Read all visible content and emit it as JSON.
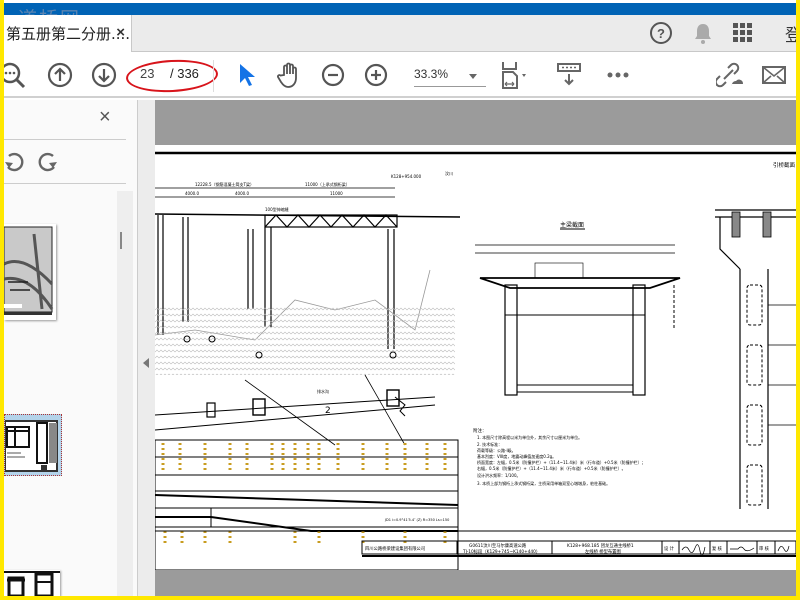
{
  "watermark": "道桥网",
  "tab": {
    "title": "第五册第二分册....",
    "close": "×"
  },
  "header_right": {
    "login": "登"
  },
  "toolbar": {
    "page_current": "23",
    "page_total": "/ 336",
    "zoom": "33.3%"
  },
  "sidebar": {
    "close": "×"
  },
  "drawing": {
    "span_left": "12228.5（钢筋混凝土简支T梁）",
    "span_right": "11000（上承式钢桁梁）",
    "sub_span": [
      "4000.0",
      "4000.0",
      "11000"
    ],
    "station": "K128+954.000",
    "direction": "汶川",
    "deck_label": "100型伸缩缝",
    "section_title": "主梁截面",
    "approach_title": "引桥截面",
    "notes_title": "附注：",
    "notes": [
      "1. 本图尺寸除高程以米为单位外，其余尺寸以厘米为单位。",
      "2. 技术标准：",
      "   荷载等级：公路-I级。",
      "   基本烈度：VIII度，地震动峰值加速度0.2g。",
      "   桥面宽度：左幅，0.5米（防撞护栏）+（11.4~11.4米）米（行车道）+0.5米（防撞护栏）；",
      "             右幅，0.5米（防撞护栏）+（11.4~11.4米）米（行车道）+0.5米（防撞护栏）。",
      "   设计洪水频率：1/100。",
      "3. 本桥上部为钢桁上承式钢桁梁，主桥采用单箱双室心墩墩身，桩柱基础。"
    ],
    "profile_text": "JD1 i=0.9°41′5.4″ (Z) R=350 Ls=150",
    "label_2": "2",
    "drain_label": "排水沟",
    "title_block": {
      "company": "四川公路桥梁建设集团有限公司",
      "project_line1": "G0611汶川至马尔康高速公路",
      "project_line2": "TJ-10标段（K129+745~K140+440）",
      "drawing_line1": "K128+968.185 团龙互通主线桥1",
      "drawing_line2": "左线桥 桥型布置图",
      "design": "设 计",
      "check": "复 核",
      "review": "审 核"
    }
  }
}
